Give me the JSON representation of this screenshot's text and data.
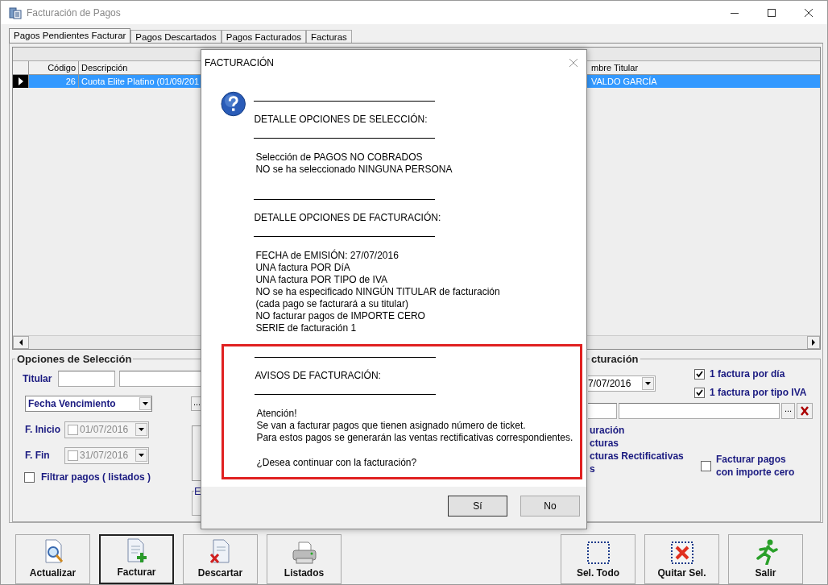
{
  "window": {
    "title": "Facturación de Pagos"
  },
  "tabs": [
    {
      "label": "Pagos Pendientes Facturar",
      "selected": true
    },
    {
      "label": "Pagos Descartados",
      "selected": false
    },
    {
      "label": "Pagos Facturados",
      "selected": false
    },
    {
      "label": "Facturas",
      "selected": false
    }
  ],
  "grid": {
    "columns": [
      "Código",
      "Descripción"
    ],
    "column_right": "mbre Titular",
    "rows": [
      {
        "codigo": "26",
        "descripcion": "Cuota Elite Platino (01/09/201",
        "titular": "VALDO GARCÍA",
        "selected": true
      }
    ]
  },
  "selection_options": {
    "title": "Opciones de Selección",
    "titular_label": "Titular",
    "date_type": "Fecha Vencimiento",
    "browse": "...",
    "dates": [
      {
        "label": "F. Inicio",
        "value": "01/07/2016",
        "checked": false
      },
      {
        "label": "F. Fin",
        "value": "31/07/2016",
        "checked": false
      }
    ],
    "filter": {
      "label": "Filtrar pagos ( listados )",
      "checked": false
    },
    "group_title": "E"
  },
  "billing_options": {
    "title": "cturación",
    "date": "7/07/2016",
    "browse": "...",
    "checks": [
      {
        "label": "1 factura por día",
        "checked": true
      },
      {
        "label": "1 factura por tipo IVA",
        "checked": true
      }
    ],
    "texts": [
      "uración",
      "cturas",
      "cturas Rectificativas",
      "s"
    ],
    "zero": {
      "label": "Facturar pagos con importe cero",
      "checked": false
    }
  },
  "dialog": {
    "title": "FACTURACIÓN",
    "sections": [
      {
        "heading": "DETALLE OPCIONES DE SELECCIÓN:",
        "highlighted": false,
        "paragraphs": [
          [
            "Selección de PAGOS NO COBRADOS",
            "NO se ha seleccionado NINGUNA PERSONA"
          ]
        ]
      },
      {
        "heading": "DETALLE OPCIONES DE FACTURACIÓN:",
        "highlighted": false,
        "paragraphs": [
          [
            "FECHA de EMISIÓN:  27/07/2016",
            "UNA factura POR DíA",
            "UNA factura POR TIPO de IVA",
            "NO se ha especificado NINGÚN TITULAR de facturación",
            "(cada pago se facturará a su titular)",
            "NO facturar pagos de IMPORTE CERO",
            "SERIE de facturación  1"
          ]
        ]
      },
      {
        "heading": "AVISOS DE FACTURACIÓN:",
        "highlighted": true,
        "paragraphs": [
          [
            "Atención!",
            "Se van a facturar pagos que tienen asignado número de ticket.",
            "Para estos pagos se generarán las ventas rectificativas correspondientes."
          ],
          [
            "¿Desea continuar con la facturación?"
          ]
        ]
      }
    ],
    "buttons": [
      {
        "label": "Sí",
        "selected": true
      },
      {
        "label": "No",
        "selected": false
      }
    ]
  },
  "toolbar": {
    "left": [
      {
        "label": "Actualizar",
        "kind": "refresh",
        "selected": false
      },
      {
        "label": "Facturar",
        "kind": "invoice",
        "selected": true
      },
      {
        "label": "Descartar",
        "kind": "discard",
        "selected": false
      },
      {
        "label": "Listados",
        "kind": "print",
        "selected": false
      }
    ],
    "right": [
      {
        "label": "Sel. Todo",
        "kind": "selectall",
        "selected": false
      },
      {
        "label": "Quitar Sel.",
        "kind": "unselect",
        "selected": false
      },
      {
        "label": "Salir",
        "kind": "exit",
        "selected": false
      }
    ]
  }
}
